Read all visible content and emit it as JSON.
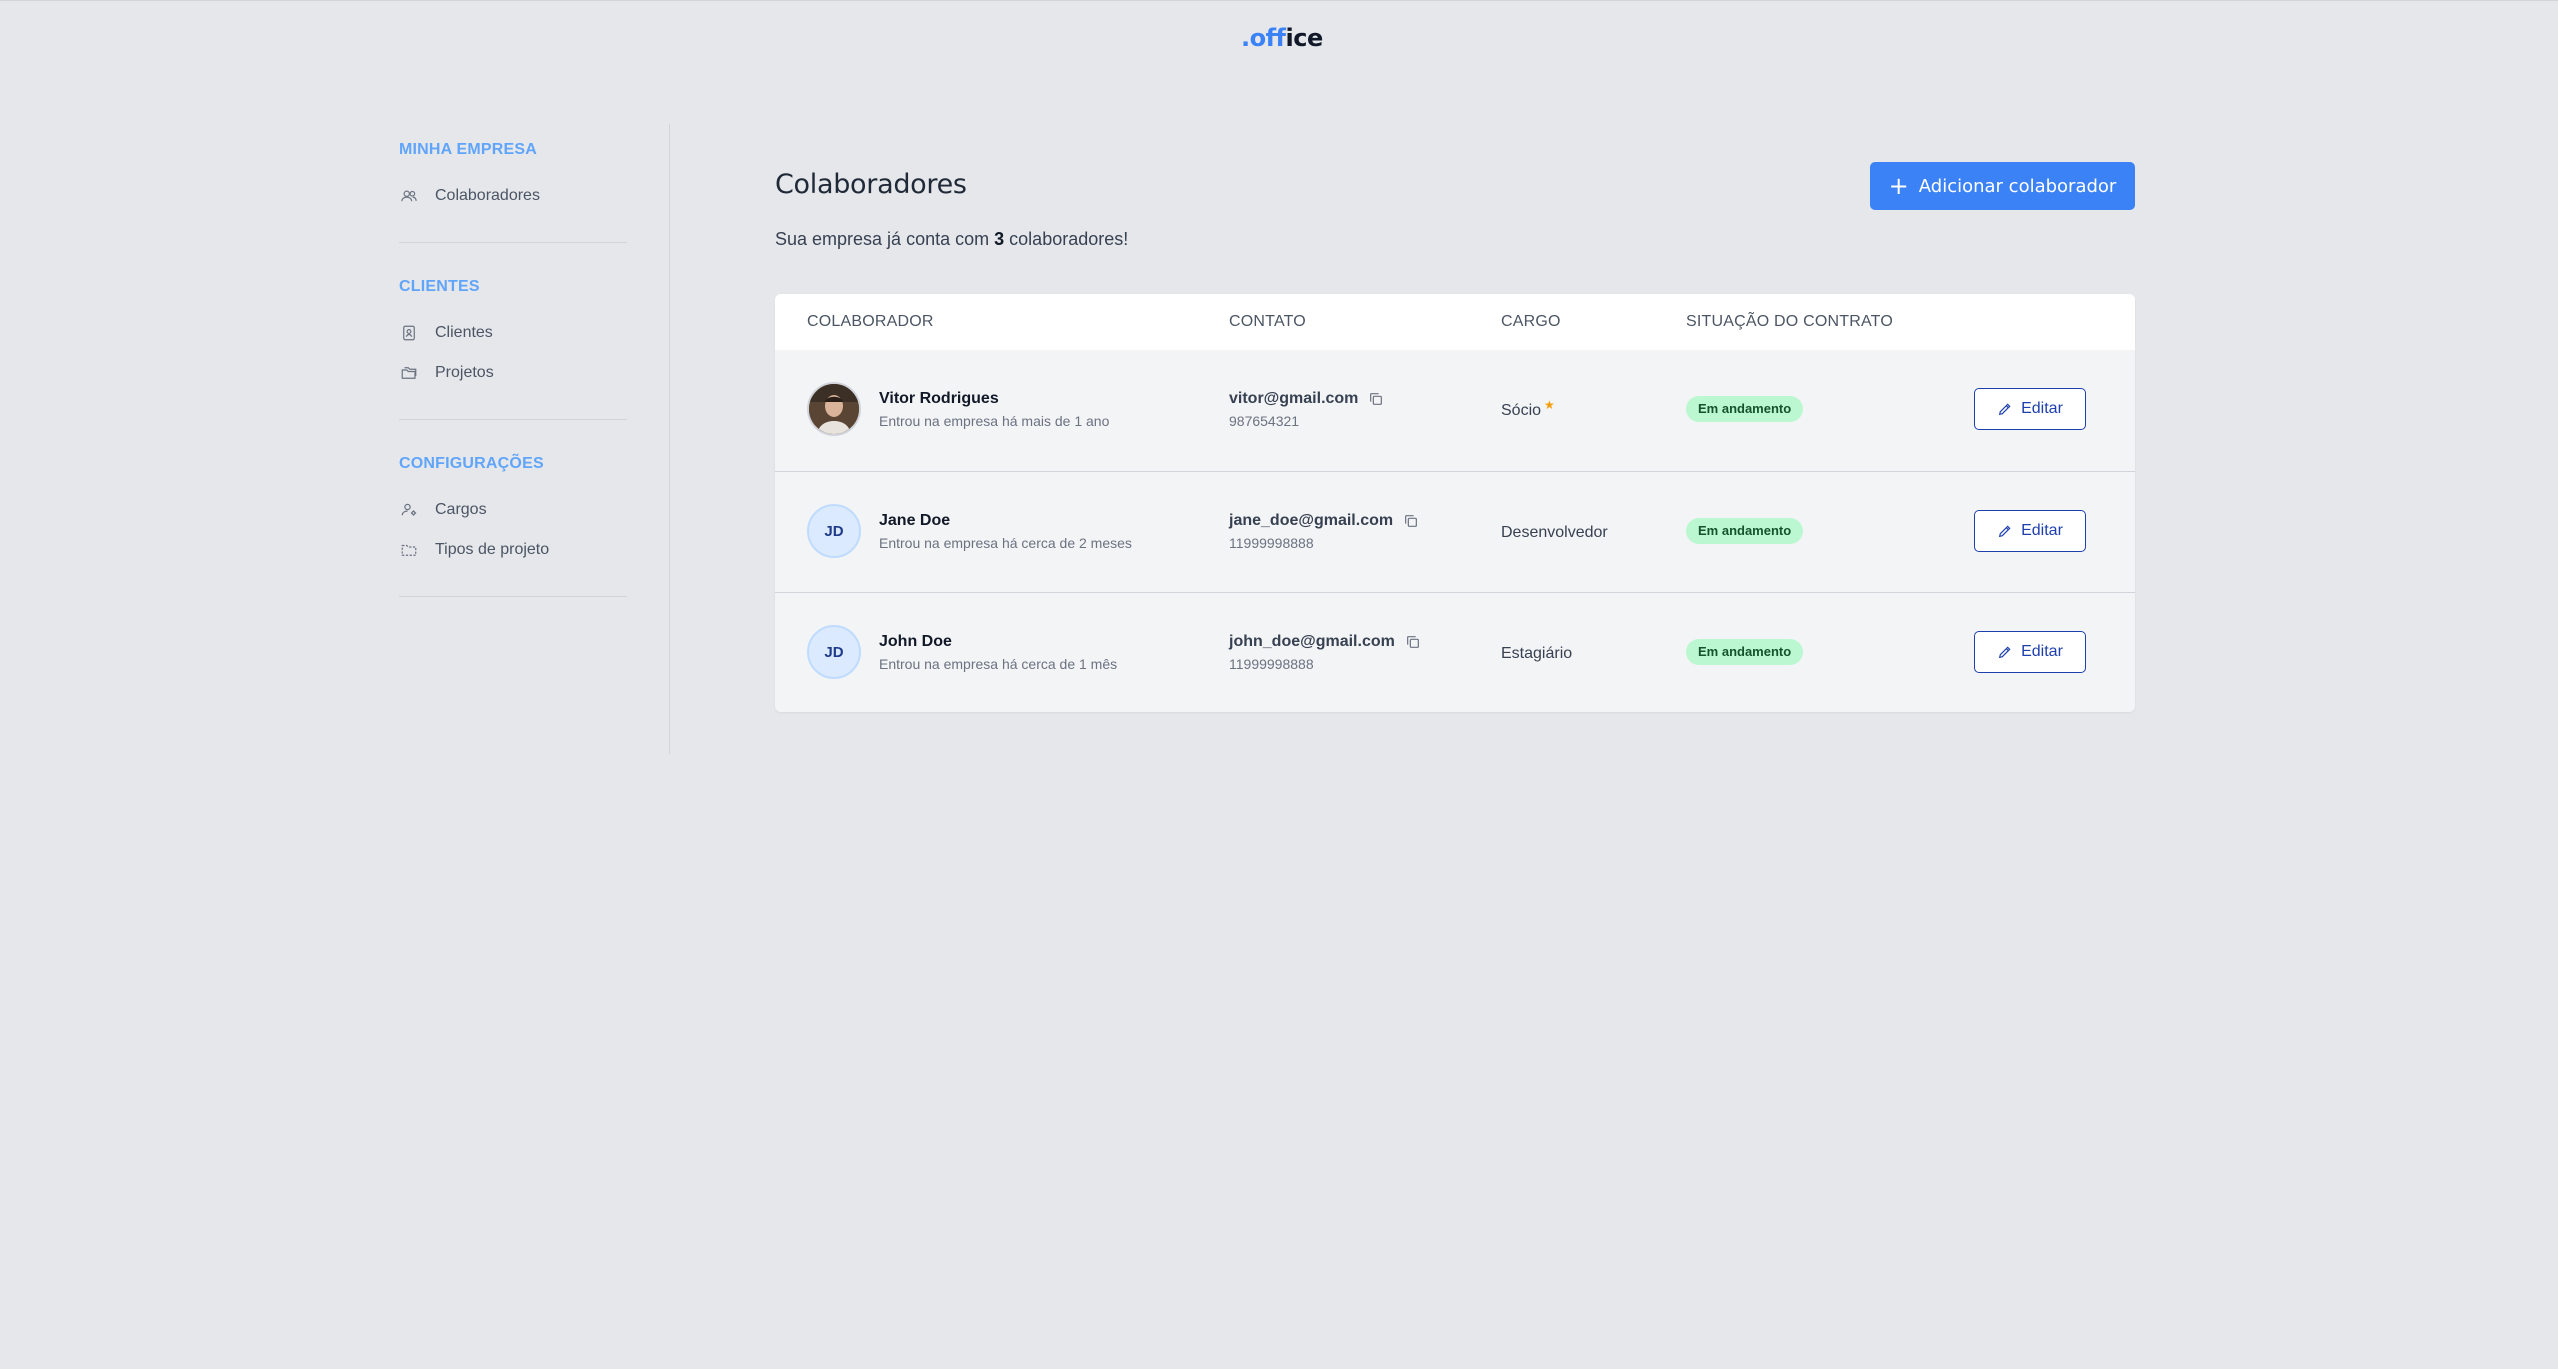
{
  "app": {
    "logo_prefix": ".off",
    "logo_suffix": "ice"
  },
  "sidebar": {
    "sections": [
      {
        "title": "MINHA EMPRESA",
        "items": [
          {
            "label": "Colaboradores",
            "icon": "users-icon"
          }
        ]
      },
      {
        "title": "CLIENTES",
        "items": [
          {
            "label": "Clientes",
            "icon": "contact-book-icon"
          },
          {
            "label": "Projetos",
            "icon": "folders-icon"
          }
        ]
      },
      {
        "title": "CONFIGURAÇÕES",
        "items": [
          {
            "label": "Cargos",
            "icon": "user-settings-icon"
          },
          {
            "label": "Tipos de projeto",
            "icon": "folder-dashed-icon"
          }
        ]
      }
    ]
  },
  "main": {
    "title": "Colaboradores",
    "subtitle_prefix": "Sua empresa já conta com",
    "subtitle_count": "3",
    "subtitle_suffix": "colaboradores!",
    "add_button": "Adicionar colaborador"
  },
  "table": {
    "headers": [
      "COLABORADOR",
      "CONTATO",
      "CARGO",
      "SITUAÇÃO DO CONTRATO"
    ],
    "rows": [
      {
        "avatar": "",
        "avatar_type": "photo",
        "name": "Vitor Rodrigues",
        "since": "Entrou na empresa há mais de 1 ano",
        "email": "vitor@gmail.com",
        "phone": "987654321",
        "cargo": "Sócio",
        "cargo_star": "★",
        "status": "Em andamento",
        "edit": "Editar"
      },
      {
        "avatar": "JD",
        "avatar_type": "initials",
        "name": "Jane Doe",
        "since": "Entrou na empresa há cerca de 2 meses",
        "email": "jane_doe@gmail.com",
        "phone": "11999998888",
        "cargo": "Desenvolvedor",
        "cargo_star": "",
        "status": "Em andamento",
        "edit": "Editar"
      },
      {
        "avatar": "JD",
        "avatar_type": "initials",
        "name": "John Doe",
        "since": "Entrou na empresa há cerca de 1 mês",
        "email": "john_doe@gmail.com",
        "phone": "11999998888",
        "cargo": "Estagiário",
        "cargo_star": "",
        "status": "Em andamento",
        "edit": "Editar"
      }
    ]
  },
  "colors": {
    "accent": "#3b82f6",
    "section_title": "#60a5fa",
    "badge_bg": "#bbf7d0",
    "badge_text": "#14532d",
    "edit_border": "#1e40af",
    "star": "#f59e0b"
  }
}
